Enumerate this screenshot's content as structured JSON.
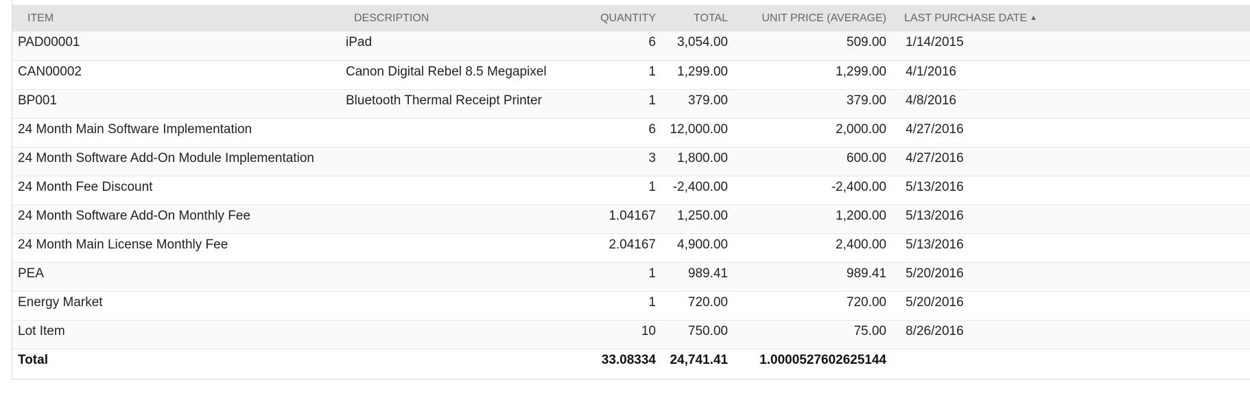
{
  "columns": {
    "item": "ITEM",
    "description": "DESCRIPTION",
    "quantity": "QUANTITY",
    "total": "TOTAL",
    "unit_price": "UNIT PRICE (AVERAGE)",
    "last_purchase_date": "LAST PURCHASE DATE",
    "sort_indicator": "▲"
  },
  "rows": [
    {
      "item": "PAD00001",
      "description": "iPad",
      "quantity": "6",
      "total": "3,054.00",
      "unit_price": "509.00",
      "date": "1/14/2015"
    },
    {
      "item": "CAN00002",
      "description": "Canon Digital Rebel 8.5 Megapixel",
      "quantity": "1",
      "total": "1,299.00",
      "unit_price": "1,299.00",
      "date": "4/1/2016"
    },
    {
      "item": "BP001",
      "description": "Bluetooth Thermal Receipt Printer",
      "quantity": "1",
      "total": "379.00",
      "unit_price": "379.00",
      "date": "4/8/2016"
    },
    {
      "item": "24 Month Main Software Implementation",
      "description": "",
      "quantity": "6",
      "total": "12,000.00",
      "unit_price": "2,000.00",
      "date": "4/27/2016"
    },
    {
      "item": "24 Month Software Add-On Module Implementation",
      "description": "",
      "quantity": "3",
      "total": "1,800.00",
      "unit_price": "600.00",
      "date": "4/27/2016"
    },
    {
      "item": "24 Month Fee Discount",
      "description": "",
      "quantity": "1",
      "total": "-2,400.00",
      "unit_price": "-2,400.00",
      "date": "5/13/2016"
    },
    {
      "item": "24 Month Software Add-On Monthly Fee",
      "description": "",
      "quantity": "1.04167",
      "total": "1,250.00",
      "unit_price": "1,200.00",
      "date": "5/13/2016"
    },
    {
      "item": "24 Month Main License Monthly Fee",
      "description": "",
      "quantity": "2.04167",
      "total": "4,900.00",
      "unit_price": "2,400.00",
      "date": "5/13/2016"
    },
    {
      "item": "PEA",
      "description": "",
      "quantity": "1",
      "total": "989.41",
      "unit_price": "989.41",
      "date": "5/20/2016"
    },
    {
      "item": "Energy Market",
      "description": "",
      "quantity": "1",
      "total": "720.00",
      "unit_price": "720.00",
      "date": "5/20/2016"
    },
    {
      "item": "Lot Item",
      "description": "",
      "quantity": "10",
      "total": "750.00",
      "unit_price": "75.00",
      "date": "8/26/2016"
    }
  ],
  "totals": {
    "label": "Total",
    "quantity": "33.08334",
    "total": "24,741.41",
    "unit_price": "1.0000527602625144"
  }
}
